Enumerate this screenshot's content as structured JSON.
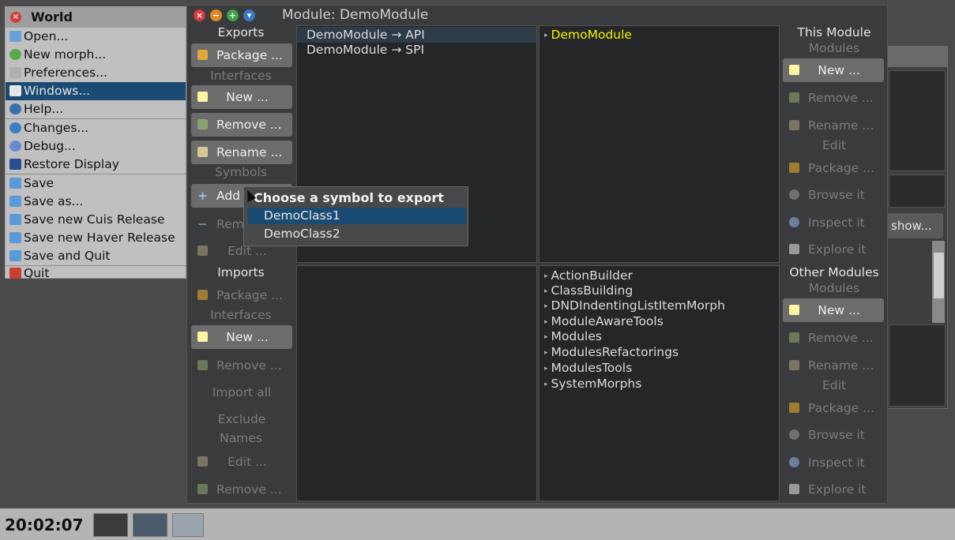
{
  "world_menu": {
    "title": "World",
    "items": [
      {
        "label": "Open...",
        "icon": "folder-icon",
        "color": "#6aa0d8"
      },
      {
        "label": "New morph...",
        "icon": "morph-icon",
        "color": "#5aa84a"
      },
      {
        "label": "Preferences...",
        "icon": "tools-icon",
        "color": "#b0b0b0"
      },
      {
        "label": "Windows...",
        "icon": "windows-icon",
        "color": "#e6e6e6"
      },
      {
        "label": "Help...",
        "icon": "help-icon",
        "color": "#3a6fb0"
      },
      {
        "label": "Changes...",
        "icon": "changes-icon",
        "color": "#3a7fc0"
      },
      {
        "label": "Debug...",
        "icon": "debug-icon",
        "color": "#6a8ad0"
      },
      {
        "label": "Restore Display",
        "icon": "display-icon",
        "color": "#2a4f90"
      },
      {
        "label": "Save",
        "icon": "save-icon",
        "color": "#5a9ad8"
      },
      {
        "label": "Save as...",
        "icon": "save-as-icon",
        "color": "#5a9ad8"
      },
      {
        "label": "Save new Cuis Release",
        "icon": "save-release-icon",
        "color": "#5a9ad8"
      },
      {
        "label": "Save new Haver Release",
        "icon": "save-release-icon",
        "color": "#5a9ad8"
      },
      {
        "label": "Save and Quit",
        "icon": "save-quit-icon",
        "color": "#5a9ad8"
      },
      {
        "label": "Quit",
        "icon": "quit-icon",
        "color": "#c84030"
      }
    ],
    "selected": "Windows..."
  },
  "module_window": {
    "title": "Module: DemoModule",
    "exports": {
      "header": "Exports",
      "package_label": "Package ...",
      "interfaces_label": "Interfaces",
      "new_label": "New ...",
      "remove_label": "Remove ...",
      "rename_label": "Rename ...",
      "symbols_label": "Symbols",
      "add_label": "Add ...",
      "remove_sym_label": "Remove ...",
      "edit_label": "Edit ...",
      "interfaces": [
        "DemoModule → API",
        "DemoModule → SPI"
      ]
    },
    "this_module": {
      "header": "This Module",
      "modules_label": "Modules",
      "new_label": "New ...",
      "remove_label": "Remove ...",
      "rename_label": "Rename ...",
      "edit_label": "Edit",
      "package_label": "Package ...",
      "browse_label": "Browse it",
      "inspect_label": "Inspect it",
      "explore_label": "Explore it",
      "items": [
        "DemoModule"
      ]
    },
    "imports": {
      "header": "Imports",
      "package_label": "Package ...",
      "interfaces_label": "Interfaces",
      "new_label": "New ...",
      "remove_label": "Remove ...",
      "import_all_label": "Import all",
      "exclude_label": "Exclude",
      "names_label": "Names",
      "edit_label": "Edit ...",
      "remove_names_label": "Remove ..."
    },
    "other_modules": {
      "header": "Other Modules",
      "modules_label": "Modules",
      "new_label": "New ...",
      "remove_label": "Remove ...",
      "rename_label": "Rename ...",
      "edit_label": "Edit",
      "package_label": "Package ...",
      "browse_label": "Browse it",
      "inspect_label": "Inspect it",
      "explore_label": "Explore it",
      "items": [
        "ActionBuilder",
        "ClassBuilding",
        "DNDIndentingListItemMorph",
        "ModuleAwareTools",
        "Modules",
        "ModulesRefactorings",
        "ModulesTools",
        "SystemMorphs"
      ]
    }
  },
  "popup": {
    "title": "Choose a symbol to export",
    "options": [
      "DemoClass1",
      "DemoClass2"
    ],
    "selected": "DemoClass1"
  },
  "background_window": {
    "button_label": "show..."
  },
  "taskbar": {
    "clock": "20:02:07"
  },
  "colors": {
    "accent_selection": "#1b4b73",
    "highlight_text": "#f2f200"
  }
}
